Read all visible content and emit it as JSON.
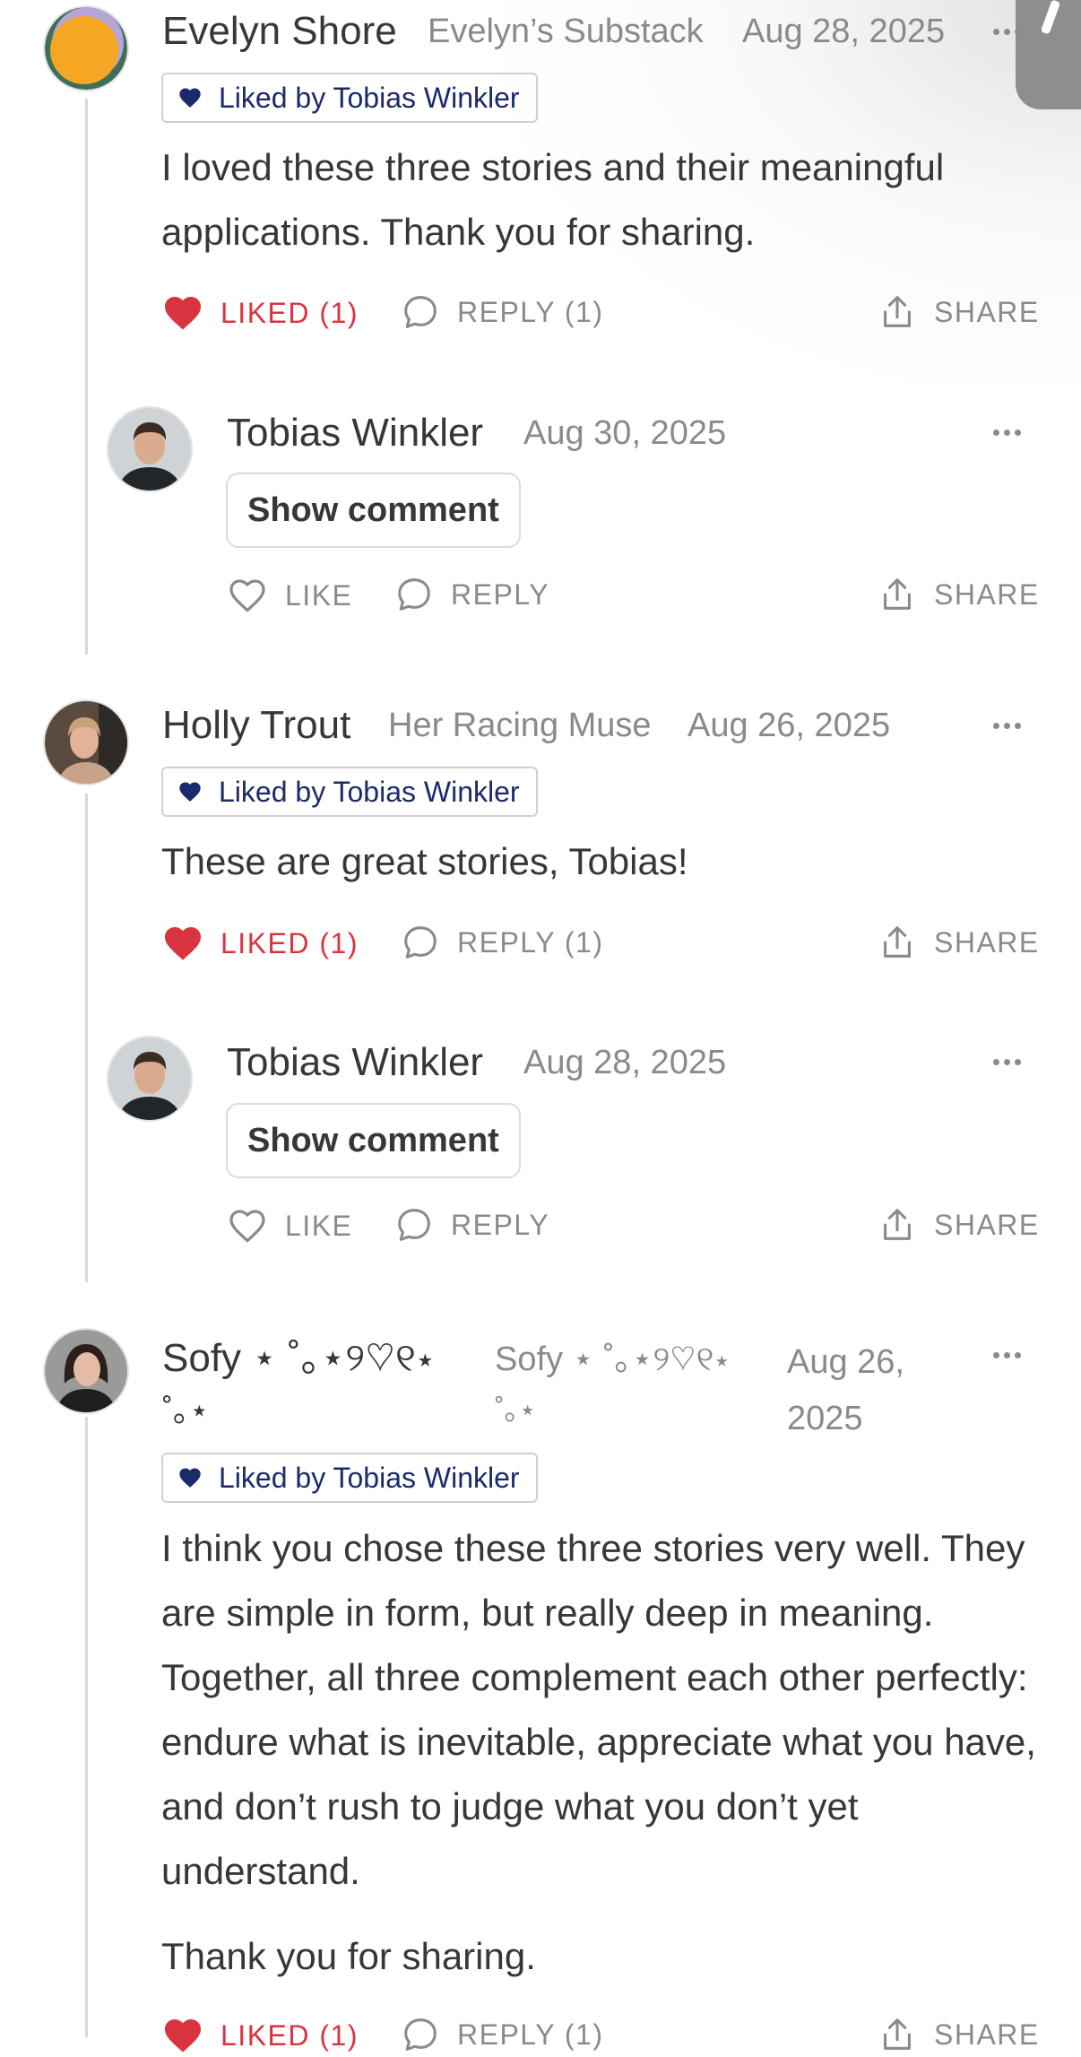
{
  "colors": {
    "liked": "#d9343e",
    "liked_by_heart": "#1b2a6b",
    "muted": "#8a8a8a",
    "text": "#363737"
  },
  "comments": [
    {
      "author": "Evelyn Shore",
      "publication": "Evelyn’s Substack",
      "date": "Aug 28, 2025",
      "liked_by": "Liked by Tobias Winkler",
      "body": "I loved these three stories and their meaningful applications. Thank you for sharing.",
      "like_label": "LIKED (1)",
      "reply_label": "REPLY (1)",
      "share_label": "SHARE",
      "reply": {
        "author": "Tobias Winkler",
        "date": "Aug 30, 2025",
        "show_label": "Show comment",
        "like_label": "LIKE",
        "reply_label": "REPLY",
        "share_label": "SHARE"
      }
    },
    {
      "author": "Holly Trout",
      "publication": "Her Racing Muse",
      "date": "Aug 26, 2025",
      "liked_by": "Liked by Tobias Winkler",
      "body": "These are great stories, Tobias!",
      "like_label": "LIKED (1)",
      "reply_label": "REPLY (1)",
      "share_label": "SHARE",
      "reply": {
        "author": "Tobias Winkler",
        "date": "Aug 28, 2025",
        "show_label": "Show comment",
        "like_label": "LIKE",
        "reply_label": "REPLY",
        "share_label": "SHARE"
      }
    },
    {
      "author_line1": "Sofy ⋆ ˚｡⋆୨♡୧⋆",
      "author_line2": "˚｡⋆",
      "publication_line1": "Sofy ⋆ ˚｡⋆୨♡୧⋆",
      "publication_line2": "˚｡⋆",
      "date_line1": "Aug 26,",
      "date_line2": "2025",
      "liked_by": "Liked by Tobias Winkler",
      "body_p1": "I think you chose these three stories very well. They are simple in form, but really deep in meaning. Together, all three complement each other perfectly: endure what is inevitable, appreciate what you have, and don’t rush to judge what you don’t yet understand.",
      "body_p2": "Thank you for sharing.",
      "like_label": "LIKED (1)",
      "reply_label": "REPLY (1)",
      "share_label": "SHARE"
    }
  ]
}
